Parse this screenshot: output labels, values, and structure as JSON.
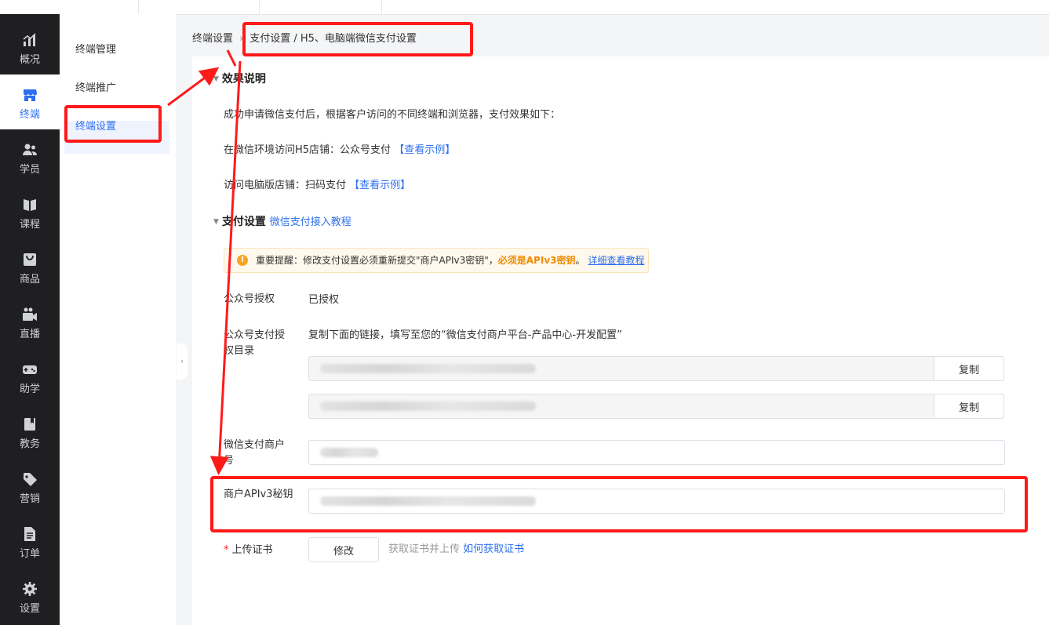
{
  "nav": [
    {
      "label": "概况",
      "icon": "chart-icon"
    },
    {
      "label": "终端",
      "icon": "store-icon",
      "active": true
    },
    {
      "label": "学员",
      "icon": "users-icon"
    },
    {
      "label": "课程",
      "icon": "book-icon"
    },
    {
      "label": "商品",
      "icon": "bag-icon"
    },
    {
      "label": "直播",
      "icon": "video-icon"
    },
    {
      "label": "助学",
      "icon": "gamepad-icon"
    },
    {
      "label": "教务",
      "icon": "notebook-icon"
    },
    {
      "label": "营销",
      "icon": "tag-icon"
    },
    {
      "label": "订单",
      "icon": "file-icon"
    },
    {
      "label": "设置",
      "icon": "gear-icon"
    }
  ],
  "subnav": [
    "终端管理",
    "终端推广",
    "终端设置"
  ],
  "breadcrumb": {
    "root": "终端设置",
    "current": "支付设置 / H5、电脑端微信支付设置"
  },
  "effect": {
    "title": "效果说明",
    "intro": "成功申请微信支付后，根据客户访问的不同终端和浏览器，支付效果如下：",
    "wechat_line": "在微信环境访问H5店铺：公众号支付",
    "pc_line": "访问电脑版店铺：扫码支付",
    "example_link": "【查看示例】"
  },
  "pay": {
    "title": "支付设置",
    "tutorial_link": "微信支付接入教程",
    "notice_prefix": "重要提醒：修改支付设置必须重新提交\"商户APIv3密钥\"，",
    "notice_strong": "必须是APIv3密钥",
    "notice_end": "。",
    "notice_link": "详细查看教程",
    "auth_label": "公众号授权",
    "auth_value": "已授权",
    "dir_label": "公众号支付授权目录",
    "dir_desc": "复制下面的链接，填写至您的“微信支付商户平台-产品中心-开发配置”",
    "copy_label": "复制",
    "merchant_label": "微信支付商户号",
    "apikey_label": "商户APIv3秘钥",
    "cert_label": "上传证书",
    "cert_required": "*",
    "modify_label": "修改",
    "cert_hint": "获取证书并上传",
    "cert_link": "如何获取证书"
  },
  "colors": {
    "accent": "#2d6ff0",
    "sidebar": "#1f1f22",
    "annotation": "#ff1a1a",
    "warning": "#f5a623"
  }
}
